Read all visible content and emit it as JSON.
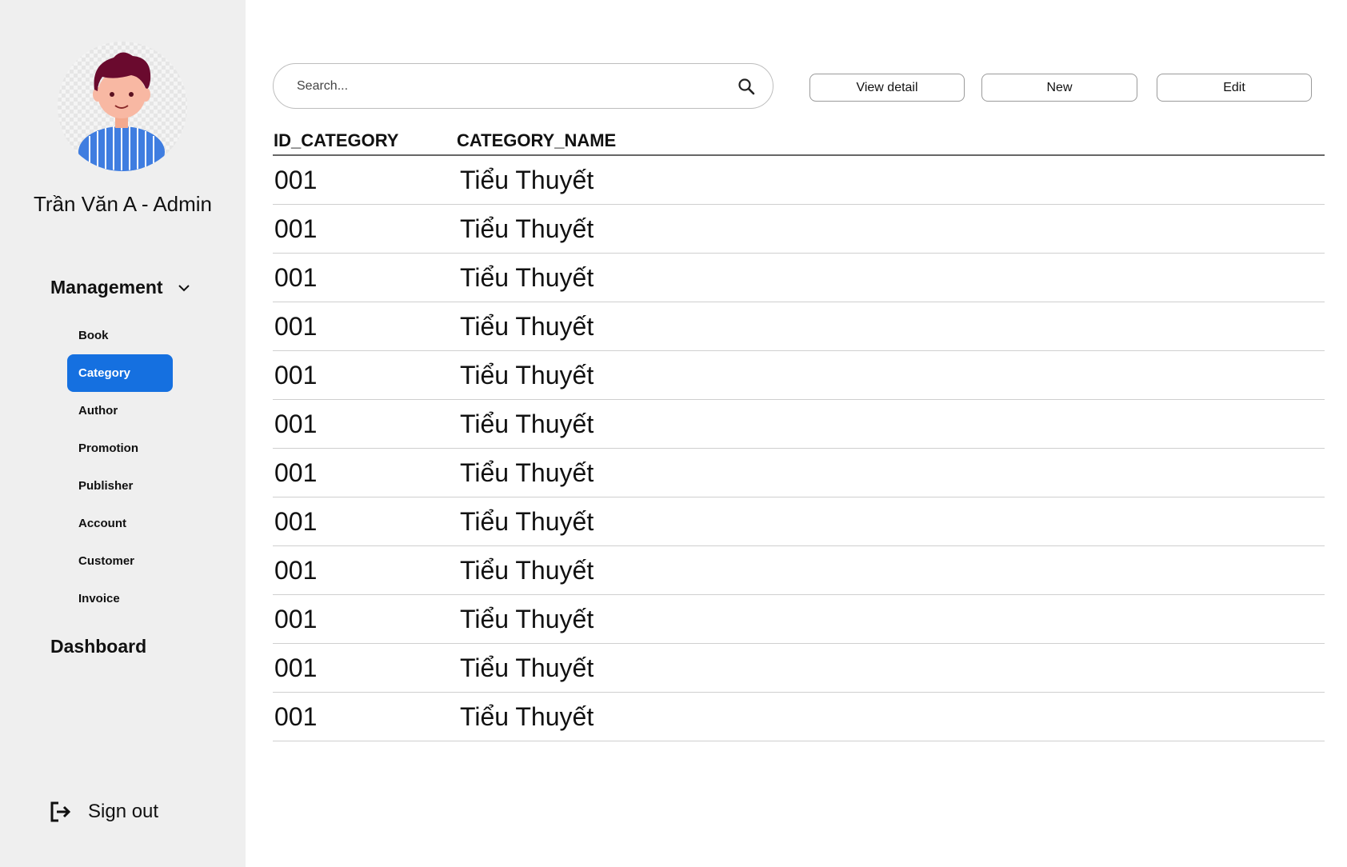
{
  "user": {
    "name": "Trần Văn A - Admin"
  },
  "sidebar": {
    "management_label": "Management",
    "items": [
      {
        "label": "Book",
        "active": false
      },
      {
        "label": "Category",
        "active": true
      },
      {
        "label": "Author",
        "active": false
      },
      {
        "label": "Promotion",
        "active": false
      },
      {
        "label": "Publisher",
        "active": false
      },
      {
        "label": "Account",
        "active": false
      },
      {
        "label": "Customer",
        "active": false
      },
      {
        "label": "Invoice",
        "active": false
      }
    ],
    "dashboard_label": "Dashboard",
    "signout_label": "Sign out"
  },
  "search": {
    "placeholder": "Search...",
    "value": ""
  },
  "toolbar": {
    "view_label": "View detail",
    "new_label": "New",
    "edit_label": "Edit"
  },
  "table": {
    "headers": [
      "ID_CATEGORY",
      "CATEGORY_NAME"
    ],
    "rows": [
      [
        "001",
        "Tiểu Thuyết"
      ],
      [
        "001",
        "Tiểu Thuyết"
      ],
      [
        "001",
        "Tiểu Thuyết"
      ],
      [
        "001",
        "Tiểu Thuyết"
      ],
      [
        "001",
        "Tiểu Thuyết"
      ],
      [
        "001",
        "Tiểu Thuyết"
      ],
      [
        "001",
        "Tiểu Thuyết"
      ],
      [
        "001",
        "Tiểu Thuyết"
      ],
      [
        "001",
        "Tiểu Thuyết"
      ],
      [
        "001",
        "Tiểu Thuyết"
      ],
      [
        "001",
        "Tiểu Thuyết"
      ],
      [
        "001",
        "Tiểu Thuyết"
      ]
    ]
  },
  "colors": {
    "sidebar_bg": "#efefef",
    "accent": "#1570e0"
  },
  "icons": {
    "dropdown": "chevron-down-icon",
    "search": "search-icon",
    "signout": "sign-out-icon"
  }
}
